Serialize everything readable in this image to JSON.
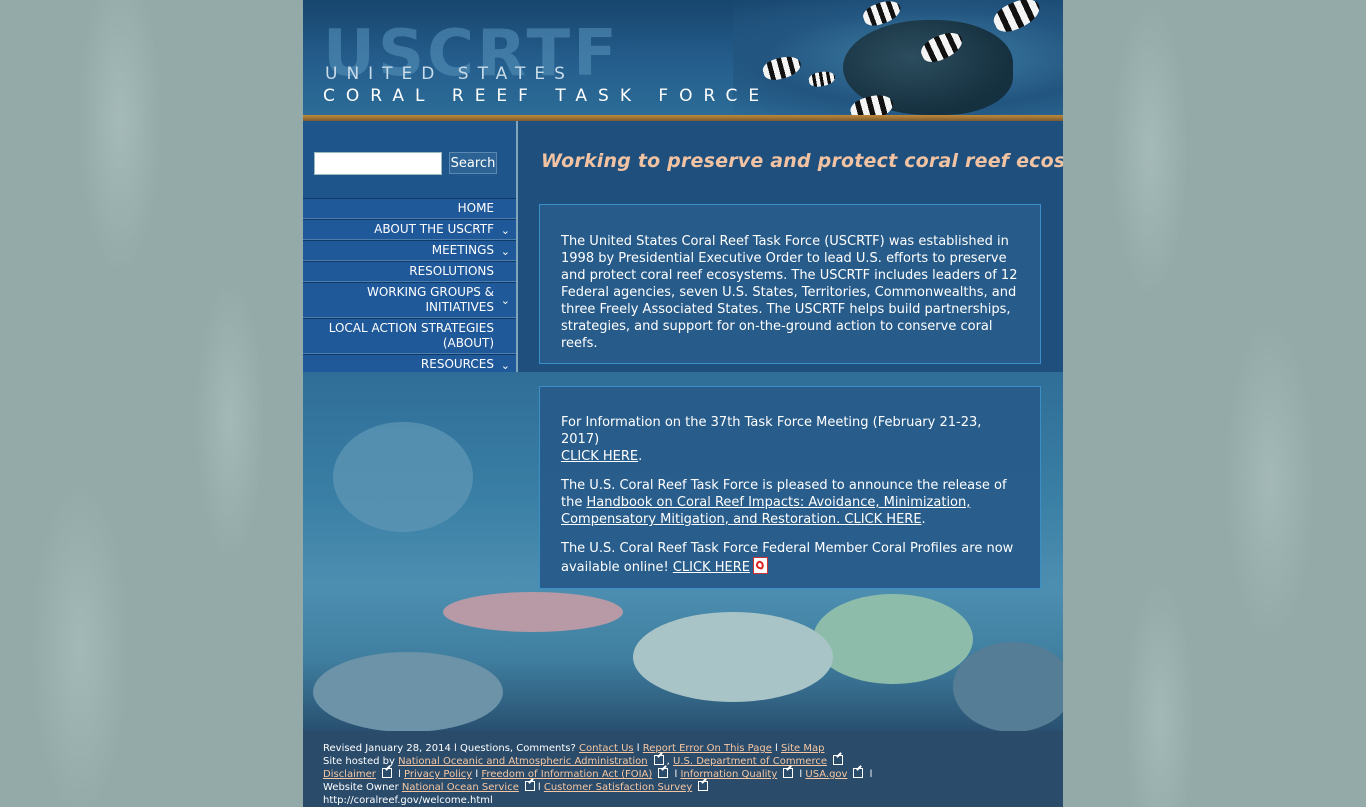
{
  "header": {
    "brand_big": "USCRTF",
    "brand_line1": "UNITED STATES",
    "brand_line2": "CORAL REEF TASK FORCE"
  },
  "search": {
    "placeholder": "",
    "value": "",
    "button_label": "Search"
  },
  "nav": [
    {
      "label": "HOME",
      "has_chevron": false
    },
    {
      "label": "ABOUT THE USCRTF",
      "has_chevron": true
    },
    {
      "label": "MEETINGS",
      "has_chevron": true
    },
    {
      "label": "RESOLUTIONS",
      "has_chevron": false
    },
    {
      "label": "WORKING GROUPS & INITIATIVES",
      "has_chevron": true
    },
    {
      "label": "LOCAL ACTION STRATEGIES (ABOUT)",
      "has_chevron": false
    },
    {
      "label": "RESOURCES",
      "has_chevron": true
    }
  ],
  "main": {
    "tagline": "Working to preserve and protect coral reef ecosystems",
    "intro": "The United States Coral Reef Task Force (USCRTF) was established in 1998 by Presidential Executive Order to lead U.S. efforts to preserve and protect coral reef ecosystems. The USCRTF includes leaders of 12 Federal agencies, seven U.S. States, Territories, Commonwealths, and three Freely Associated States. The USCRTF helps build partnerships, strategies, and support for on-the-ground action to conserve coral reefs.",
    "news": {
      "p1_text": "For Information on the 37th Task Force Meeting (February 21-23, 2017)",
      "p1_link": "CLICK HERE",
      "p2_text": "The U.S. Coral Reef Task Force is pleased to announce the release of the",
      "p2_link": "Handbook on Coral Reef Impacts: Avoidance, Minimization, Compensatory Mitigation, and Restoration. CLICK HERE",
      "p3_text": "The U.S. Coral Reef Task Force Federal Member Coral Profiles are now available online!",
      "p3_link": "CLICK HERE"
    }
  },
  "footer": {
    "revised": "Revised January 28, 2014",
    "questions": "Questions, Comments?",
    "contact": "Contact Us",
    "report": "Report Error On This Page",
    "sitemap": "Site Map",
    "hosted_by": "Site hosted by",
    "noaa": "National Oceanic and Atmospheric Administration",
    "doc": "U.S. Department of Commerce",
    "disclaimer": "Disclaimer",
    "privacy": "Privacy Policy",
    "foia": "Freedom of Information Act (FOIA)",
    "info_quality": "Information Quality",
    "usagov": "USA.gov",
    "owner": "Website Owner",
    "nos": "National Ocean Service",
    "survey": "Customer Satisfaction Survey",
    "url": "http://coralreef.gov/welcome.html"
  },
  "colors": {
    "tagline": "#f1c3a3",
    "footer_link": "#f6c7a2",
    "nav_bg": "#20599a",
    "content_box": "#285c8a",
    "page_bg": "#93aaa8"
  }
}
